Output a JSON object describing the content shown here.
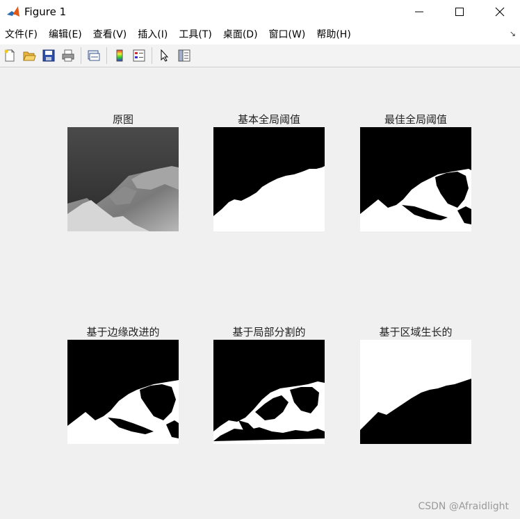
{
  "window": {
    "title": "Figure 1",
    "icon": "matlab-logo-icon",
    "controls": [
      "minimize-icon",
      "maximize-icon",
      "close-icon"
    ]
  },
  "menubar": {
    "items": [
      "文件(F)",
      "编辑(E)",
      "查看(V)",
      "插入(I)",
      "工具(T)",
      "桌面(D)",
      "窗口(W)",
      "帮助(H)"
    ],
    "overflow_icon": "dock-arrow-icon"
  },
  "toolbar": {
    "icons": [
      "new-figure-icon",
      "open-icon",
      "save-icon",
      "print-icon",
      "link-plot-icon",
      "colorbar-icon",
      "legend-icon",
      "pointer-icon",
      "property-editor-icon"
    ]
  },
  "subplots": [
    {
      "title": "原图"
    },
    {
      "title": "基本全局阈值"
    },
    {
      "title": "最佳全局阈值"
    },
    {
      "title": "基于边缘改进的"
    },
    {
      "title": "基于局部分割的"
    },
    {
      "title": "基于区域生长的"
    }
  ],
  "watermark": "CSDN @Afraidlight",
  "colors": {
    "titlebar_bg": "#ffffff",
    "figure_bg": "#f0f0f0",
    "image_dark": "#000000",
    "image_light": "#ffffff"
  }
}
